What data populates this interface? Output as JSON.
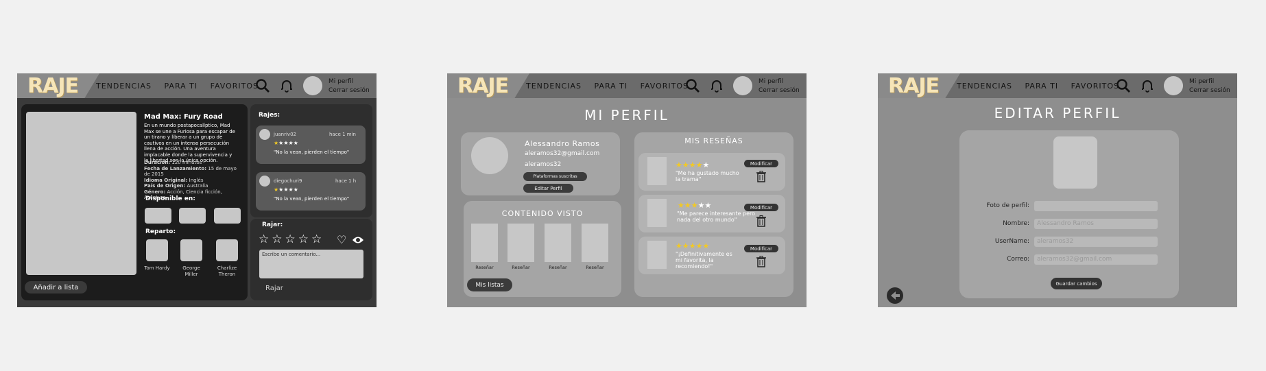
{
  "nav": {
    "logo": "RAJE",
    "links": [
      "TENDENCIAS",
      "PARA TI",
      "FAVORITOS"
    ],
    "profile_link": "Mi perfil",
    "logout_link": "Cerrar sesión"
  },
  "movie": {
    "title": "Mad Max: Fury Road",
    "synopsis": "En un mundo postapocalíptico, Mad Max se une a Furiosa para escapar de un tirano y liberar a un grupo de cautivos en un intenso persecución llena de acción. Una aventura implacable donde la supervivencia y la libertad son la única opción.",
    "duration_label": "Duración:",
    "duration": "120 minutos",
    "release_label": "Fecha de Lanzamiento:",
    "release": "15 de mayo de 2015",
    "language_label": "Idioma Original:",
    "language": "Inglés",
    "country_label": "País de Origen:",
    "country": "Australia",
    "genre_label": "Género:",
    "genre": "Acción, Ciencia ficción, Aventura",
    "available_label": "Disponible en:",
    "cast_label": "Reparto:",
    "cast": [
      "Tom Hardy",
      "George Miller",
      "Charlize Theron"
    ],
    "add_list_button": "Añadir a lista"
  },
  "rajes": {
    "heading": "Rajes:",
    "items": [
      {
        "user": "juanriv02",
        "time": "hace 1 min",
        "text": "\"No la vean, pierden el tiempo\"",
        "rating": 1
      },
      {
        "user": "diegochuri9",
        "time": "hace 1 h",
        "text": "\"No la vean, pierden el tiempo\"",
        "rating": 1
      }
    ]
  },
  "rajar": {
    "heading": "Rajar:",
    "placeholder": "Escribe un comentario...",
    "submit": "Rajar"
  },
  "profile": {
    "title": "MI PERFIL",
    "name": "Alessandro Ramos",
    "email": "aleramos32@gmail.com",
    "username": "aleramos32",
    "platforms_button": "Plataformas suscritas",
    "edit_button": "Editar Perfil",
    "seen_title": "CONTENIDO VISTO",
    "review_button": "Reseñar",
    "lists_button": "Mis listas",
    "reviews_title": "MIS RESEÑAS",
    "modify_button": "Modificar",
    "reviews": [
      {
        "text": "\"Me ha gustado mucho la trama\"",
        "rating": 4
      },
      {
        "text": "\"Me parece interesante pero nada del otro mundo\"",
        "rating": 3
      },
      {
        "text": "\"¡Definitivamente es mi favorita, la recomiendo!\"",
        "rating": 5
      }
    ]
  },
  "edit": {
    "title": "EDITAR PERFIL",
    "photo_label": "Foto de perfil:",
    "name_label": "Nombre:",
    "name_value": "Alessandro Ramos",
    "username_label": "UserName:",
    "username_value": "aleramos32",
    "email_label": "Correo:",
    "email_value": "aleramos32@gmail.com",
    "save_button": "Guardar cambios"
  },
  "colors": {
    "star": "#f2c924",
    "logo": "#f6e5b8",
    "dark_button": "#333333"
  }
}
